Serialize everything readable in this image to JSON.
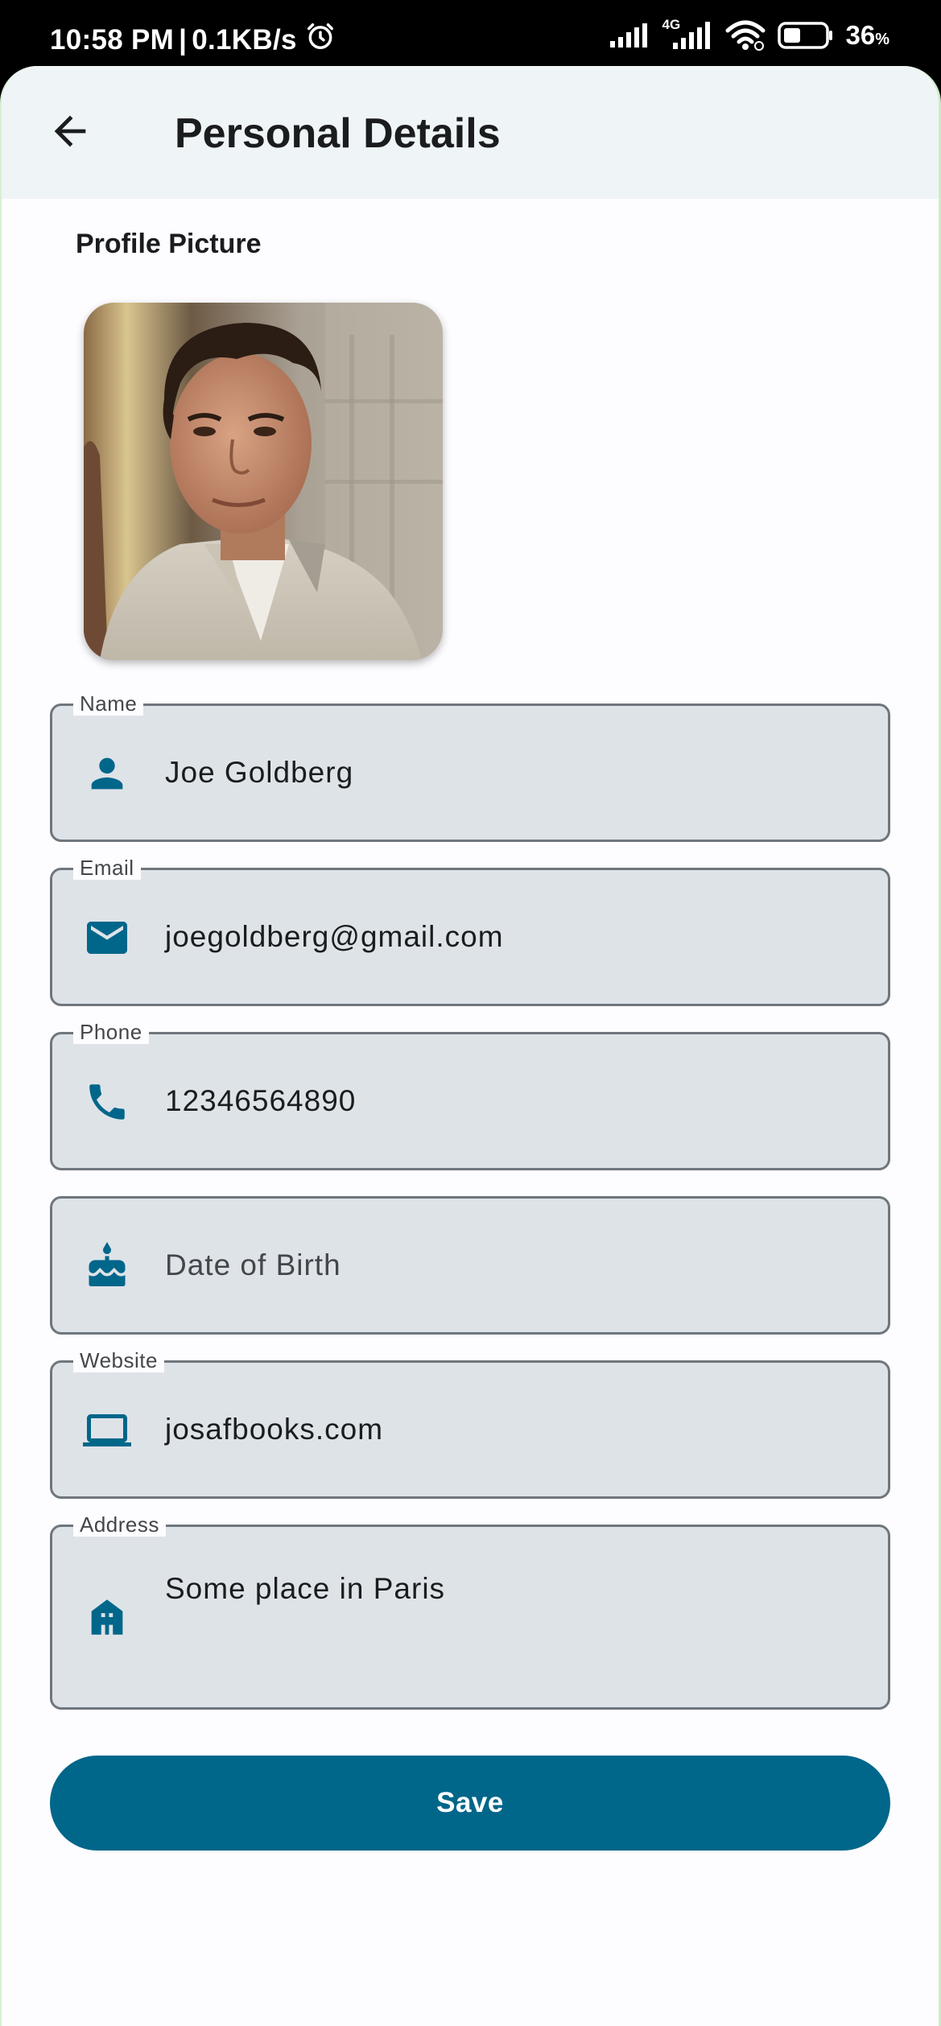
{
  "status_bar": {
    "time": "10:58 PM",
    "separator": "|",
    "speed": "0.1KB/s",
    "network_type": "4G",
    "battery_level": "36",
    "battery_unit": "%",
    "icons": [
      "alarm-icon",
      "signal-icon",
      "signal-4g-icon",
      "wifi-icon",
      "battery-icon"
    ]
  },
  "app_bar": {
    "title": "Personal Details",
    "back_icon": "arrow-back-icon"
  },
  "profile": {
    "section_label": "Profile Picture"
  },
  "form": {
    "name": {
      "label": "Name",
      "value": "Joe Goldberg",
      "icon": "person-icon"
    },
    "email": {
      "label": "Email",
      "value": "joegoldberg@gmail.com",
      "icon": "mail-icon"
    },
    "phone": {
      "label": "Phone",
      "value": "12346564890",
      "icon": "phone-icon"
    },
    "dob": {
      "placeholder": "Date of Birth",
      "icon": "cake-icon"
    },
    "website": {
      "label": "Website",
      "value": "josafbooks.com",
      "icon": "laptop-icon"
    },
    "address": {
      "label": "Address",
      "value": "Some place in Paris",
      "icon": "home-icon"
    }
  },
  "actions": {
    "save_label": "Save"
  },
  "colors": {
    "accent": "#00668a",
    "field_fill": "#dee3e8",
    "field_border": "#6f767d",
    "app_bar": "#eff4f7",
    "background": "#fdfcfe"
  }
}
